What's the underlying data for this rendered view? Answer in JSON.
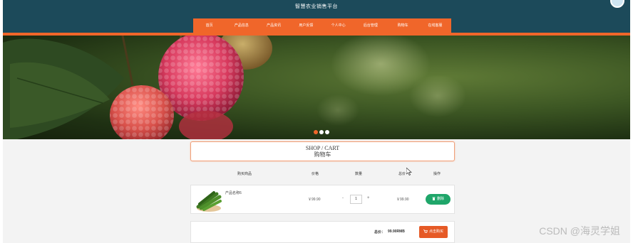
{
  "site": {
    "title": "智慧农业销售平台"
  },
  "nav": {
    "items": [
      "首页",
      "产品信息",
      "产品资讯",
      "用户反馈",
      "个人中心",
      "后台管理",
      "购物车",
      "在线客服"
    ]
  },
  "banner": {
    "dots": 3,
    "active_dot": 0
  },
  "cart": {
    "title_en": "SHOP / CART",
    "title_cn": "购物车",
    "columns": {
      "product": "购买商品",
      "price": "价格",
      "quantity": "数量",
      "total": "总价",
      "action": "操作"
    },
    "items": [
      {
        "name": "产品名称6",
        "price": "￥99.90",
        "minus": "-",
        "quantity": "1",
        "plus": "+",
        "subtotal": "￥99.90",
        "delete_label": "删除"
      }
    ],
    "total_label": "总价：",
    "total_value": "99.90RMB",
    "buy_label": "点击购买"
  },
  "watermark": "CSDN @海灵学姐",
  "colors": {
    "header_bg": "#1c4a5a",
    "nav_accent": "#f0662a",
    "delete_green": "#1fa66a",
    "buy_orange": "#e65a26"
  },
  "icons": {
    "delete": "trash-icon",
    "buy": "cart-icon"
  }
}
